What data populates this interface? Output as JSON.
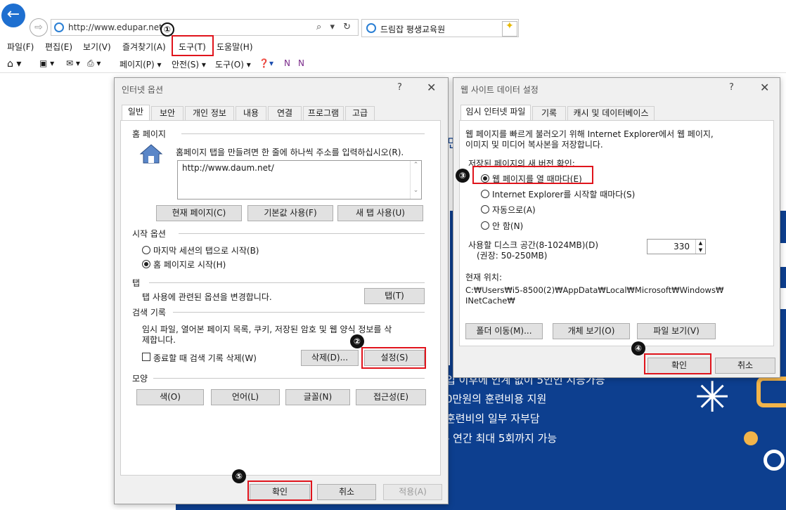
{
  "browser": {
    "address": "http://www.edupar.net/",
    "address_tools": "⌕ ▾ ↻",
    "tab_title": "드림잡 평생교육원",
    "tab_close": "✕",
    "menu": [
      "파일(F)",
      "편집(E)",
      "보기(V)",
      "즐겨찾기(A)",
      "도구(T)",
      "도움말(H)"
    ],
    "toolbar": [
      "페이지(P) ▾",
      "안전(S) ▾",
      "도구(O) ▾"
    ]
  },
  "webpage": {
    "lines": [
      "0만원의 훈련비용 지원",
      "훈련비의 일부 자부담",
      "- 연간 최대 5회까지 가능"
    ],
    "cropped_line": "입 이후에 인계 없이 5인인 지능가능",
    "side_char": "면"
  },
  "internet_options": {
    "title": "인터넷 옵션",
    "help": "?",
    "close": "✕",
    "tabs": [
      "일반",
      "보안",
      "개인 정보",
      "내용",
      "연결",
      "프로그램",
      "고급"
    ],
    "home": {
      "group": "홈 페이지",
      "desc": "홈페이지 탭을 만들려면 한 줄에 하나씩 주소를 입력하십시오(R).",
      "url": "http://www.daum.net/",
      "buttons": [
        "현재 페이지(C)",
        "기본값 사용(F)",
        "새 탭 사용(U)"
      ]
    },
    "startup": {
      "group": "시작 옵션",
      "options": [
        "마지막 세션의 탭으로 시작(B)",
        "홈 페이지로 시작(H)"
      ],
      "selected": 1
    },
    "tabs_group": {
      "group": "탭",
      "desc": "탭 사용에 관련된 옵션을 변경합니다.",
      "button": "탭(T)"
    },
    "history": {
      "group": "검색 기록",
      "desc1": "임시 파일, 열어본 페이지 목록, 쿠키, 저장된 암호 및 웹 양식 정보를 삭",
      "desc2": "제합니다.",
      "checkbox": "종료할 때 검색 기록 삭제(W)",
      "delete_button": "삭제(D)...",
      "settings_button": "설정(S)"
    },
    "appearance": {
      "group": "모양",
      "buttons": [
        "색(O)",
        "언어(L)",
        "글꼴(N)",
        "접근성(E)"
      ]
    },
    "footer": {
      "ok": "확인",
      "cancel": "취소",
      "apply": "적용(A)"
    }
  },
  "website_data": {
    "title": "웹 사이트 데이터 설정",
    "help": "?",
    "close": "✕",
    "tabs": [
      "임시 인터넷 파일",
      "기록",
      "캐시 및 데이터베이스"
    ],
    "desc1": "웹 페이지를 빠르게 불러오기 위해 Internet Explorer에서 웹 페이지,",
    "desc2": "이미지 및 미디어 복사본을 저장합니다.",
    "check_label": "저장된 페이지의 새 버전 확인:",
    "options": [
      "웹 페이지를 열 때마다(E)",
      "Internet Explorer를 시작할 때마다(S)",
      "자동으로(A)",
      "안 함(N)"
    ],
    "selected": 0,
    "disk_label1": "사용할 디스크 공간(8-1024MB)(D)",
    "disk_label2": "(권장: 50-250MB)",
    "disk_value": "330",
    "location_label": "현재 위치:",
    "location1": "C:₩Users₩i5-8500(2)₩AppData₩Local₩Microsoft₩Windows₩",
    "location2": "INetCache₩",
    "buttons": [
      "폴더 이동(M)...",
      "개체 보기(O)",
      "파일 보기(V)"
    ],
    "footer": {
      "ok": "확인",
      "cancel": "취소"
    }
  },
  "steps": [
    "①",
    "②",
    "③",
    "④",
    "⑤"
  ],
  "colors": {
    "highlight": "#e0141c",
    "ie_blue": "#1e6fd0",
    "web_navy": "#0d3f8f",
    "accent_gold": "#f2b44a"
  }
}
